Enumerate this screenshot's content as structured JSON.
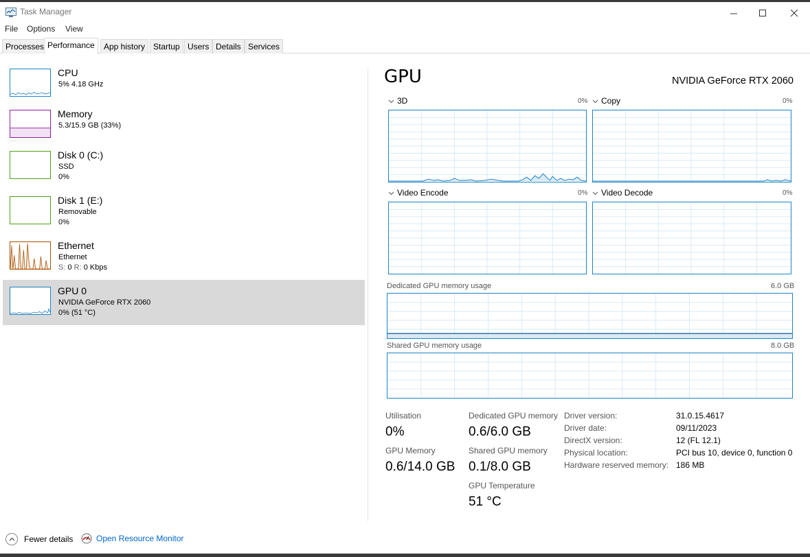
{
  "window": {
    "title": "Task Manager",
    "minimize_glyph": "—",
    "maximize_glyph": "☐",
    "close_glyph": "✕"
  },
  "menu": [
    "File",
    "Options",
    "View"
  ],
  "tabs": [
    "Processes",
    "Performance",
    "App history",
    "Startup",
    "Users",
    "Details",
    "Services"
  ],
  "active_tab": "Performance",
  "sidebar": {
    "cpu": {
      "title": "CPU",
      "line1": "5% 4.18 GHz",
      "color": "#1b82c4"
    },
    "memory": {
      "title": "Memory",
      "line1": "5.3/15.9 GB (33%)",
      "color": "#8b1da1"
    },
    "disk0": {
      "title": "Disk 0 (C:)",
      "line1": "SSD",
      "line2": "0%",
      "color": "#4da014"
    },
    "disk1": {
      "title": "Disk 1 (E:)",
      "line1": "Removable",
      "line2": "0%",
      "color": "#4da014"
    },
    "ethernet": {
      "title": "Ethernet",
      "line1": "Ethernet",
      "line2_s": "S:",
      "line2_s_val": "0",
      "line2_r": "R:",
      "line2_r_val": "0 Kbps",
      "color": "#a74f01"
    },
    "gpu0": {
      "title": "GPU 0",
      "line1": "NVIDIA GeForce RTX 2060",
      "line2": "0%  (51 °C)",
      "color": "#1b82c4"
    }
  },
  "main": {
    "title": "GPU",
    "device_name": "NVIDIA GeForce RTX 2060",
    "engines": [
      {
        "name": "3D",
        "pct": "0%"
      },
      {
        "name": "Copy",
        "pct": "0%"
      },
      {
        "name": "Video Encode",
        "pct": "0%"
      },
      {
        "name": "Video Decode",
        "pct": "0%"
      }
    ],
    "dedicated_mem": {
      "label": "Dedicated GPU memory usage",
      "max": "6.0 GB"
    },
    "shared_mem": {
      "label": "Shared GPU memory usage",
      "max": "8.0 GB"
    },
    "stats": {
      "utilisation_label": "Utilisation",
      "utilisation": "0%",
      "gpu_memory_label": "GPU Memory",
      "gpu_memory": "0.6/14.0 GB",
      "dedicated_label": "Dedicated GPU memory",
      "dedicated": "0.6/6.0 GB",
      "shared_label": "Shared GPU memory",
      "shared": "0.1/8.0 GB",
      "temp_label": "GPU Temperature",
      "temp": "51 °C"
    },
    "info": [
      {
        "label": "Driver version:",
        "value": "31.0.15.4617"
      },
      {
        "label": "Driver date:",
        "value": "09/11/2023"
      },
      {
        "label": "DirectX version:",
        "value": "12 (FL 12.1)"
      },
      {
        "label": "Physical location:",
        "value": "PCI bus 10, device 0, function 0"
      },
      {
        "label": "Hardware reserved memory:",
        "value": "186 MB"
      }
    ]
  },
  "footer": {
    "fewer_details": "Fewer details",
    "open_resource_monitor": "Open Resource Monitor"
  },
  "colors": {
    "gpu_line": "#1b82c4",
    "grid": "#d9eaf5",
    "selected_bg": "#d9d9d9"
  }
}
